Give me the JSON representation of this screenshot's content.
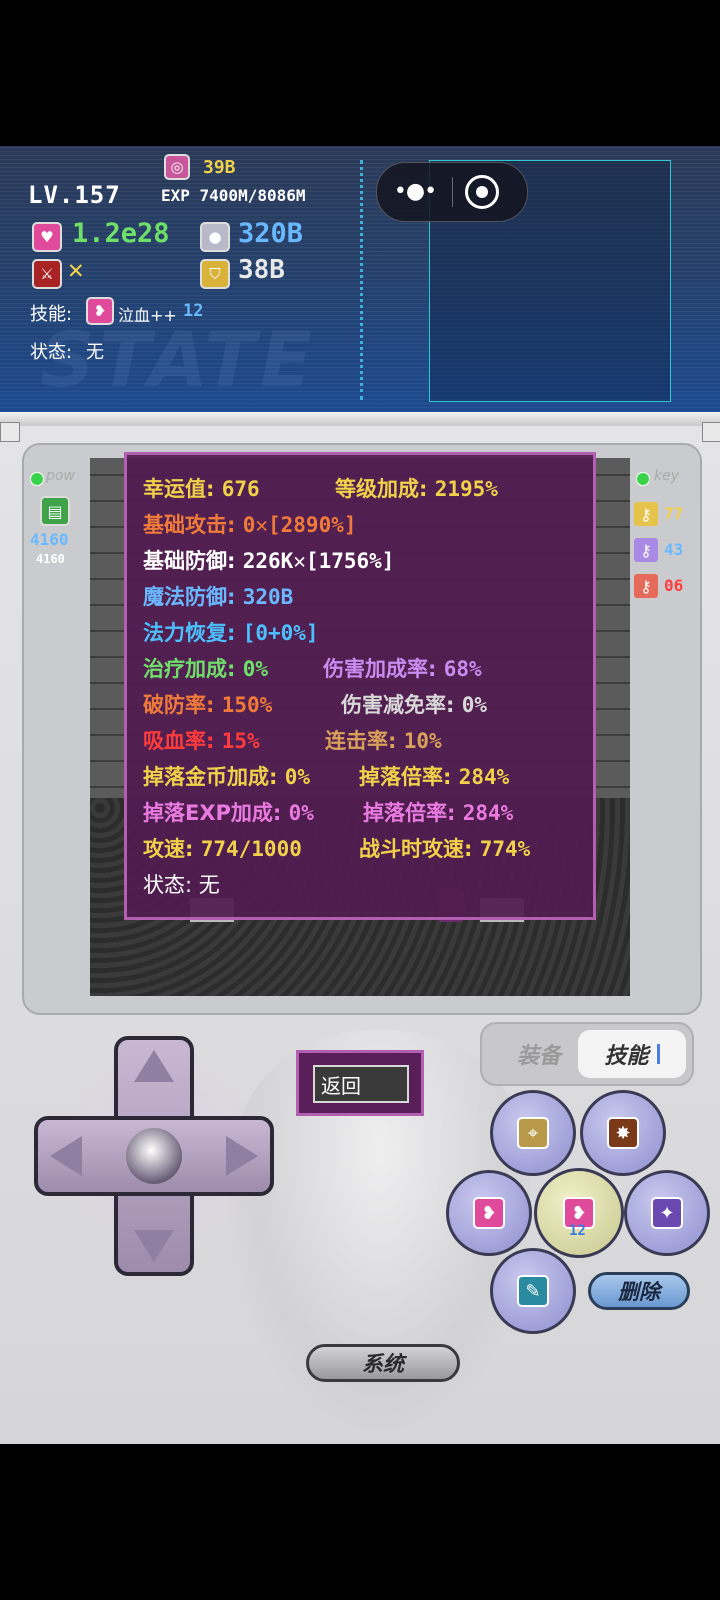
{
  "hud": {
    "level": "LV.157",
    "exp": "EXP 7400M/8086M",
    "gold": "39B",
    "hp": "1.2e28",
    "attack": "✕",
    "mana": "320B",
    "defense": "38B",
    "skill_label": "技能:",
    "skill_name": "泣血++",
    "skill_level": "12",
    "state_label": "状态:",
    "state_value": "无",
    "watermark": "STATE"
  },
  "left_sidebar": {
    "title": "pow",
    "value_big": "4160",
    "value_small": "4160"
  },
  "right_sidebar": {
    "title": "key",
    "keys": [
      {
        "color": "#e6c34a",
        "count": "77"
      },
      {
        "color": "#a98be6",
        "count": "43"
      },
      {
        "color": "#e66a5a",
        "count": "06"
      }
    ]
  },
  "stats": {
    "luck_label": "幸运值:",
    "luck_value": "676",
    "level_bonus_label": "等级加成:",
    "level_bonus_value": "2195%",
    "base_atk_label": "基础攻击:",
    "base_atk_value": "0✕[2890%]",
    "base_def_label": "基础防御:",
    "base_def_value": "226K✕[1756%]",
    "magic_def_label": "魔法防御:",
    "magic_def_value": "320B",
    "mana_regen_label": "法力恢复:",
    "mana_regen_value": "[0+0%]",
    "heal_bonus_label": "治疗加成:",
    "heal_bonus_value": "0%",
    "dmg_bonus_label": "伤害加成率:",
    "dmg_bonus_value": "68%",
    "armor_break_label": "破防率:",
    "armor_break_value": "150%",
    "dmg_reduce_label": "伤害减免率:",
    "dmg_reduce_value": "0%",
    "lifesteal_label": "吸血率:",
    "lifesteal_value": "15%",
    "combo_label": "连击率:",
    "combo_value": "10%",
    "gold_drop_label": "掉落金币加成:",
    "gold_drop_value": "0%",
    "gold_mult_label": "掉落倍率:",
    "gold_mult_value": "284%",
    "exp_drop_label": "掉落EXP加成:",
    "exp_drop_value": "0%",
    "exp_mult_label": "掉落倍率:",
    "exp_mult_value": "284%",
    "atk_speed_label": "攻速:",
    "atk_speed_value": "774/1000",
    "battle_speed_label": "战斗时攻速:",
    "battle_speed_value": "774%",
    "state_label": "状态:",
    "state_value": "无"
  },
  "controls": {
    "back_label": "返回",
    "tab_equip": "装备",
    "tab_skill": "技能",
    "skill_button_level": "12",
    "delete_label": "删除",
    "system_label": "系统"
  },
  "colors": {
    "overlay_bg": "#521c50",
    "overlay_border": "#b25fb2",
    "yellow": "#f2d14a",
    "orange": "#f07a3a",
    "blue": "#6ab8ff",
    "green": "#6ee06a",
    "purple": "#c98bf0",
    "red": "#ff3b3b"
  }
}
